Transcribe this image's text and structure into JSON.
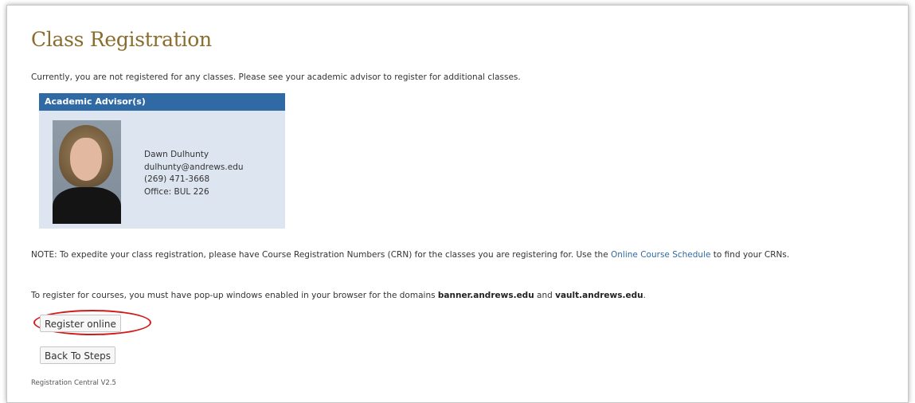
{
  "page": {
    "title": "Class Registration",
    "intro": "Currently, you are not registered for any classes. Please see your academic advisor to register for additional classes."
  },
  "advisor": {
    "header": "Academic Advisor(s)",
    "name": "Dawn Dulhunty",
    "email": "dulhunty@andrews.edu",
    "phone": "(269) 471-3668",
    "office": "Office: BUL 226",
    "photo_icon": "advisor-photo"
  },
  "note": {
    "text_before": "NOTE: To expedite your class registration, please have Course Registration Numbers (CRN) for the classes you are registering for. Use the ",
    "link_text": "Online Course Schedule",
    "text_after": " to find your CRNs."
  },
  "popup_note": {
    "text_before": "To register for courses, you must have pop-up windows enabled in your browser for the domains ",
    "domain1": "banner.andrews.edu",
    "text_middle": " and ",
    "domain2": "vault.andrews.edu",
    "text_after": "."
  },
  "buttons": {
    "register_label": "Register online",
    "back_label": "Back To Steps"
  },
  "footer": {
    "version": "Registration Central V2.5"
  },
  "colors": {
    "title": "#8a6d2e",
    "header_bg": "#2f6aa5",
    "box_bg": "#dde6f0",
    "link": "#2f6aa5",
    "highlight": "#d21a1a"
  }
}
